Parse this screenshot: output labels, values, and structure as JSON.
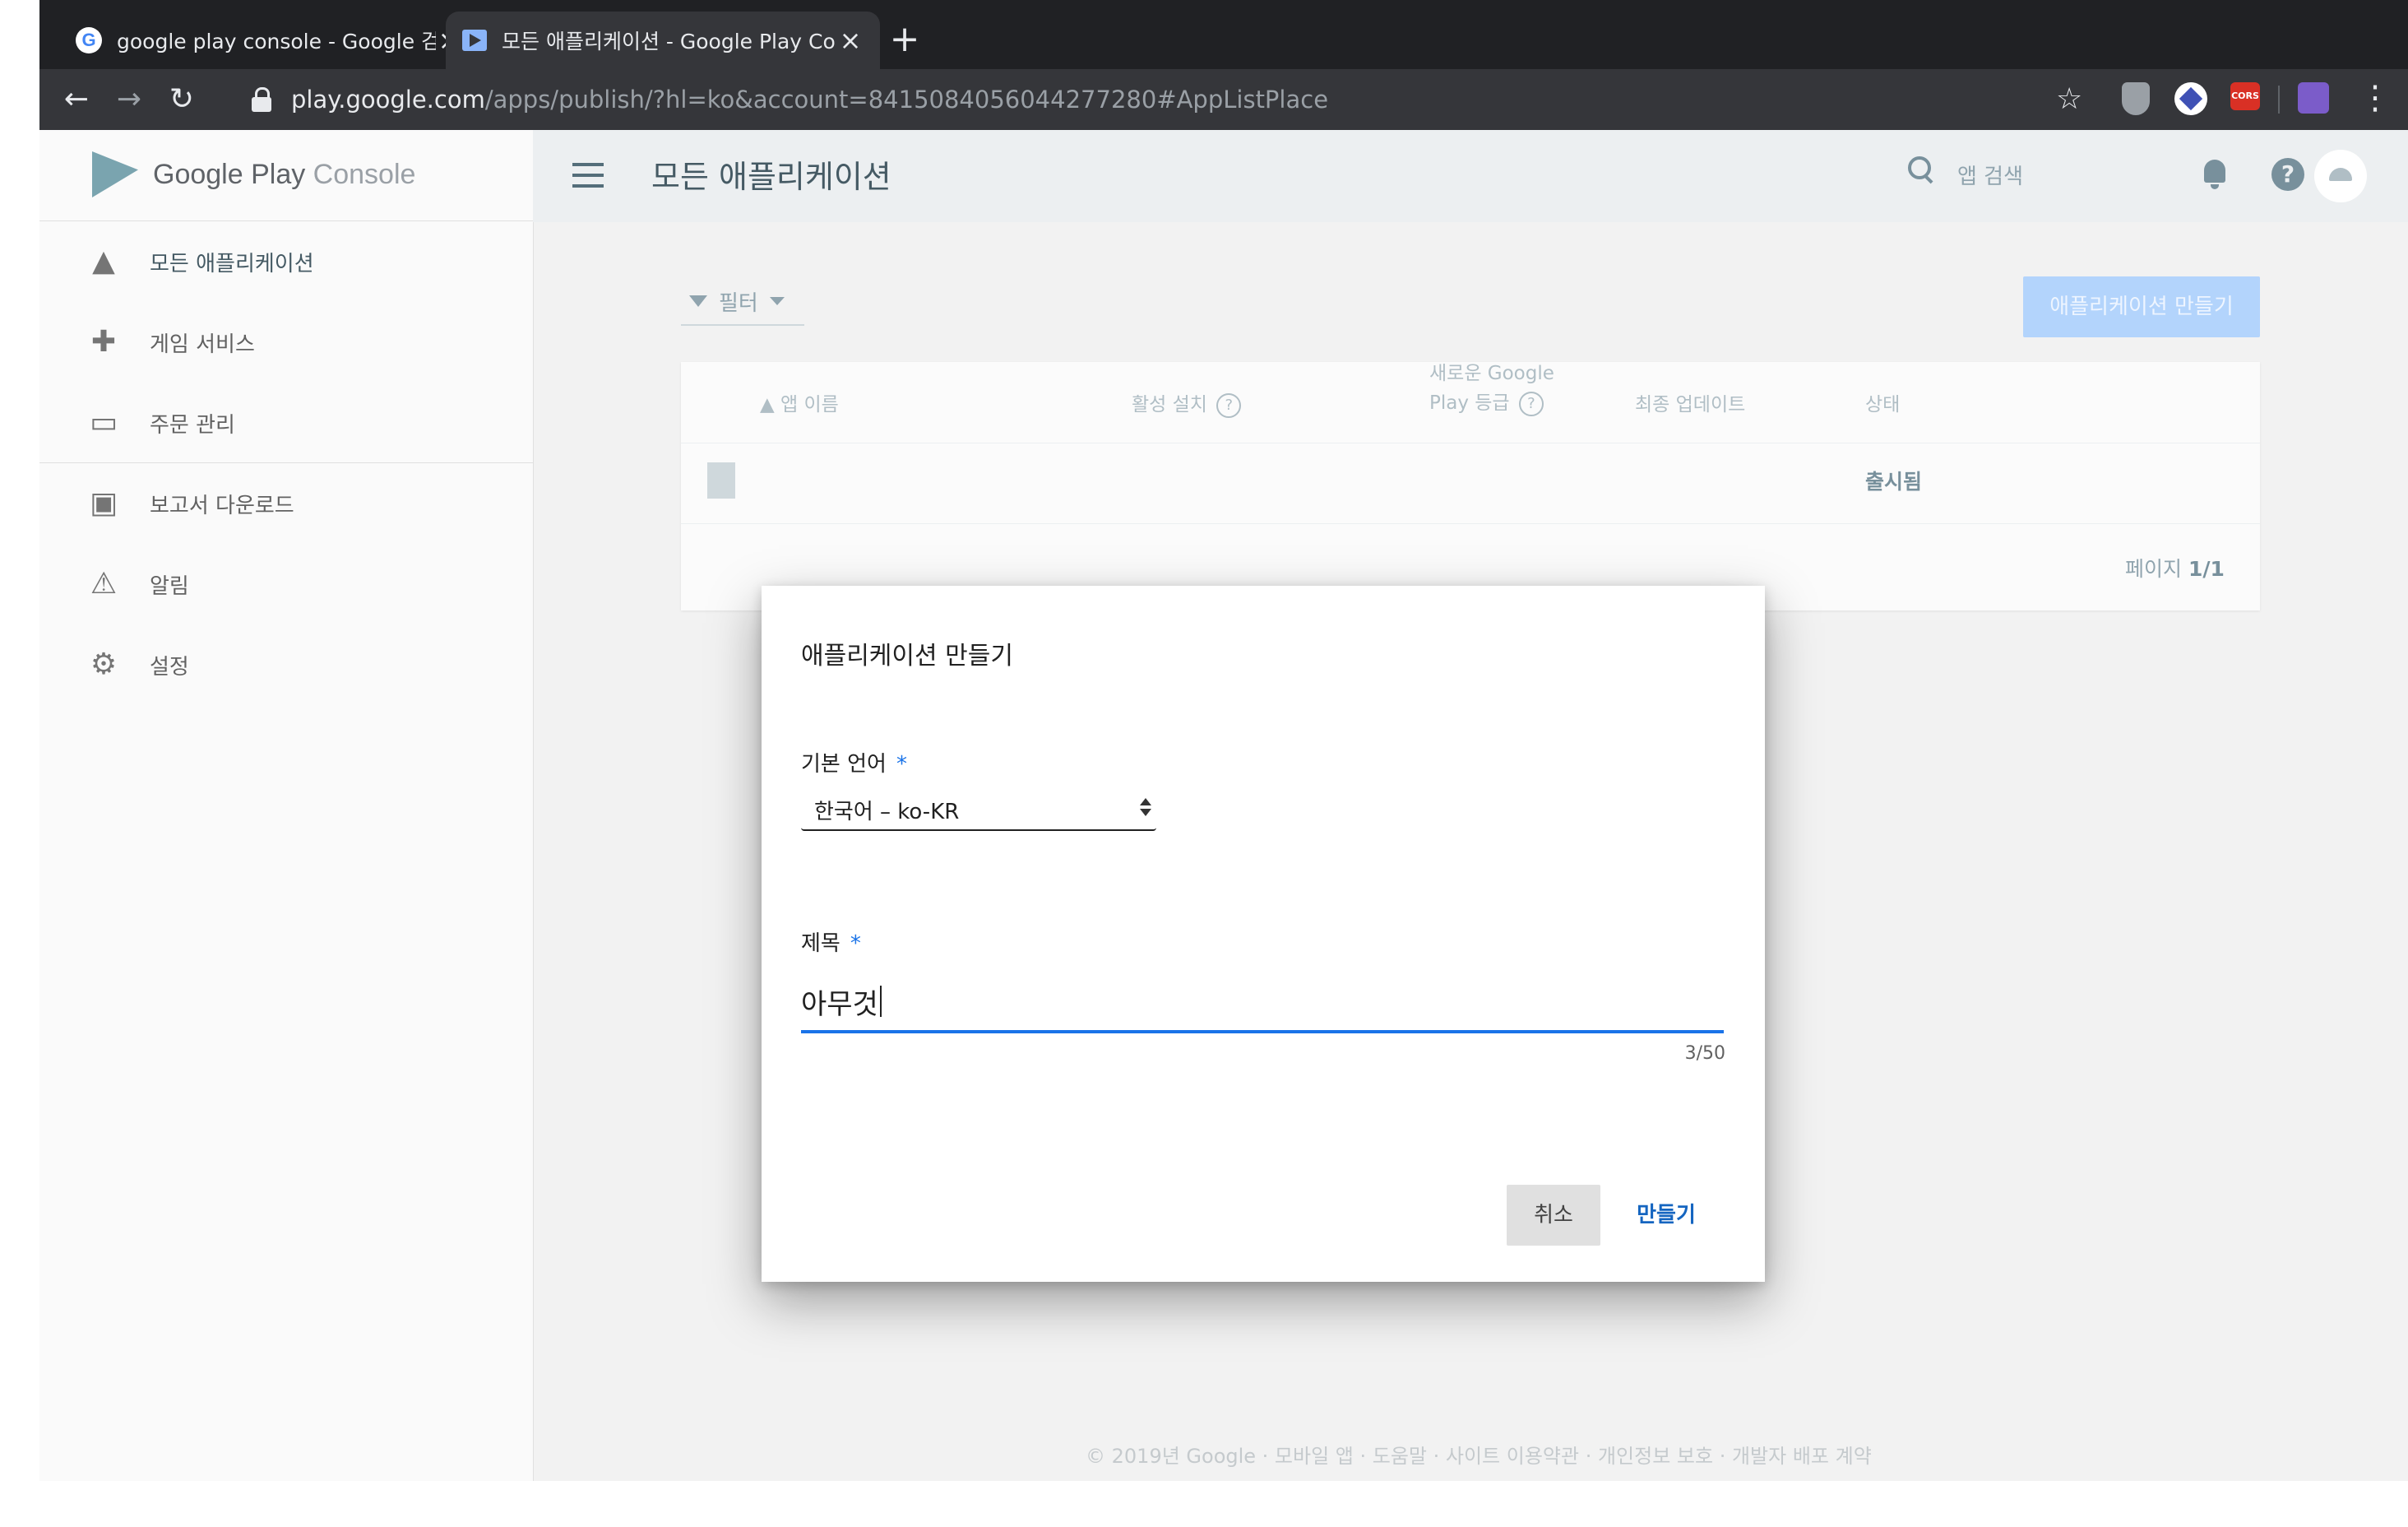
{
  "browser": {
    "tabs": [
      {
        "title": "google play console - Google 검색",
        "favicon": "google-g-icon"
      },
      {
        "title": "모든 애플리케이션 - Google Play Console",
        "favicon": "play-console-icon"
      }
    ],
    "new_tab": "+",
    "url_host": "play.google.com",
    "url_path": "/apps/publish/?hl=ko&account=8415084056044277280#AppListPlace",
    "ext_cors_label": "CORS"
  },
  "sidebar": {
    "brand_main": "Google Play",
    "brand_sub": " Console",
    "items": [
      {
        "label": "모든 애플리케이션",
        "icon": "android-icon"
      },
      {
        "label": "게임 서비스",
        "icon": "gamepad-icon"
      },
      {
        "label": "주문 관리",
        "icon": "credit-card-icon"
      },
      {
        "label": "보고서 다운로드",
        "icon": "download-report-icon"
      },
      {
        "label": "알림",
        "icon": "warning-icon"
      },
      {
        "label": "설정",
        "icon": "gear-icon"
      }
    ]
  },
  "header": {
    "title": "모든 애플리케이션",
    "search_placeholder": "앱 검색"
  },
  "toolbar": {
    "filter_label": "필터",
    "create_app_label": "애플리케이션 만들기"
  },
  "table": {
    "columns": {
      "app_name": "앱 이름",
      "active_installs": "활성 설치",
      "rating_line1": "새로운 Google",
      "rating_line2": "Play 등급",
      "last_update": "최종 업데이트",
      "status": "상태"
    },
    "rows": [
      {
        "status": "출시됨"
      }
    ],
    "pager_prefix": "페이지 ",
    "pager_value": "1/1"
  },
  "footer": "© 2019년 Google · 모바일 앱 · 도움말 · 사이트 이용약관 · 개인정보 보호 · 개발자 배포 계약",
  "dialog": {
    "title": "애플리케이션 만들기",
    "language_label": "기본 언어",
    "required_mark": "*",
    "language_value": "한국어 – ko-KR",
    "title_label": "제목",
    "title_value": "아무것",
    "counter": "3/50",
    "cancel_label": "취소",
    "create_label": "만들기"
  }
}
